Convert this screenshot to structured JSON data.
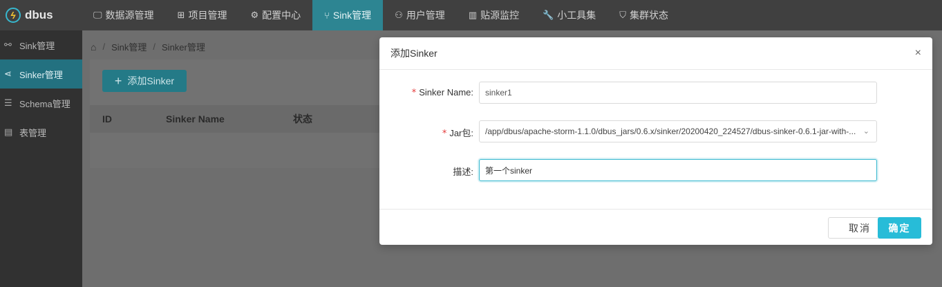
{
  "app": {
    "name": "dbus",
    "logo_icon": "lightning-logo-icon"
  },
  "nav": {
    "items": [
      {
        "label": "数据源管理",
        "icon": "monitor-icon",
        "glyph": "🖵"
      },
      {
        "label": "项目管理",
        "icon": "grid-icon",
        "glyph": "⊞"
      },
      {
        "label": "配置中心",
        "icon": "gear-icon",
        "glyph": "⚙"
      },
      {
        "label": "Sink管理",
        "icon": "fork-icon",
        "glyph": "⑂",
        "active": true
      },
      {
        "label": "用户管理",
        "icon": "user-icon",
        "glyph": "⚇"
      },
      {
        "label": "贴源监控",
        "icon": "bar-chart-icon",
        "glyph": "▥"
      },
      {
        "label": "小工具集",
        "icon": "wrench-icon",
        "glyph": "🔧"
      },
      {
        "label": "集群状态",
        "icon": "shield-icon",
        "glyph": "⛉"
      }
    ]
  },
  "sidebar": {
    "items": [
      {
        "label": "Sink管理",
        "icon": "link-icon",
        "glyph": "⚯"
      },
      {
        "label": "Sinker管理",
        "icon": "share-icon",
        "glyph": "⋖",
        "active": true
      },
      {
        "label": "Schema管理",
        "icon": "database-icon",
        "glyph": "☰"
      },
      {
        "label": "表管理",
        "icon": "table-icon",
        "glyph": "▤"
      }
    ]
  },
  "breadcrumb": {
    "items": [
      "Sink管理",
      "Sinker管理"
    ],
    "separator": "/"
  },
  "toolbar": {
    "add_label": "添加Sinker"
  },
  "table": {
    "columns": [
      "ID",
      "Sinker Name",
      "状态"
    ]
  },
  "modal": {
    "title": "添加Sinker",
    "close_glyph": "×",
    "fields": {
      "sinker_name": {
        "label": "Sinker Name",
        "value": "sinker1",
        "required": true
      },
      "jar": {
        "label": "Jar包",
        "value": "/app/dbus/apache-storm-1.1.0/dbus_jars/0.6.x/sinker/20200420_224527/dbus-sinker-0.6.1-jar-with-...",
        "required": true
      },
      "description": {
        "label": "描述",
        "value": "第一个sinker",
        "required": false
      }
    },
    "cancel_label": "取消",
    "ok_label": "确定"
  },
  "colors": {
    "accent": "#27bcd8",
    "nav_active": "#2d8592",
    "required": "#e43a3a"
  }
}
